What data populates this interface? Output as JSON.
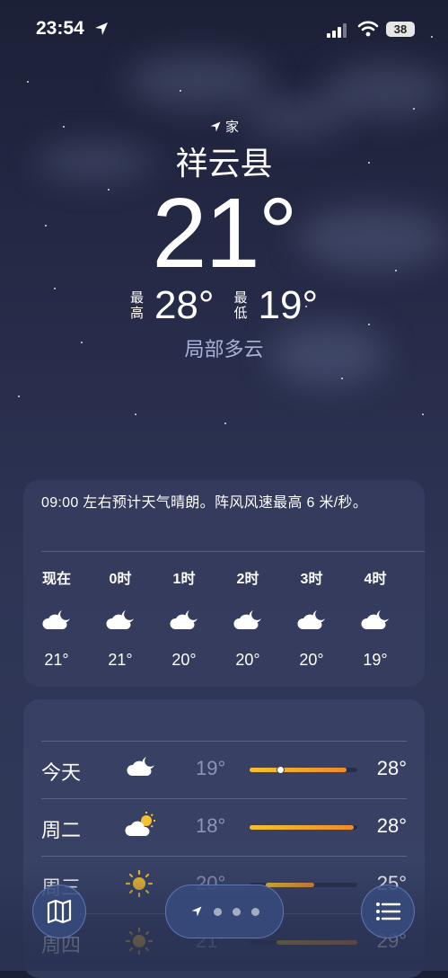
{
  "status_bar": {
    "time": "23:54",
    "battery": "38"
  },
  "location": {
    "label": "家",
    "city": "祥云县",
    "current_temp": "21°",
    "high_label": "最高",
    "high": "28°",
    "low_label": "最低",
    "low": "19°",
    "condition": "局部多云"
  },
  "hourly": {
    "summary": "09:00 左右预计天气晴朗。阵风风速最高 6 米/秒。",
    "hours": [
      {
        "label": "现在",
        "icon": "moon-cloud-icon",
        "temp": "21°"
      },
      {
        "label": "0时",
        "icon": "moon-cloud-icon",
        "temp": "21°"
      },
      {
        "label": "1时",
        "icon": "moon-cloud-icon",
        "temp": "20°"
      },
      {
        "label": "2时",
        "icon": "moon-cloud-icon",
        "temp": "20°"
      },
      {
        "label": "3时",
        "icon": "moon-cloud-icon",
        "temp": "20°"
      },
      {
        "label": "4时",
        "icon": "moon-cloud-icon",
        "temp": "19°"
      }
    ]
  },
  "daily": {
    "days": [
      {
        "name": "今天",
        "icon": "moon-cloud-icon",
        "low": "19°",
        "high": "28°",
        "bar_start": 0.0,
        "bar_end": 0.9,
        "current_dot": 0.28
      },
      {
        "name": "周二",
        "icon": "sun-cloud-icon",
        "low": "18°",
        "high": "28°",
        "bar_start": 0.0,
        "bar_end": 0.97
      },
      {
        "name": "周三",
        "icon": "sun-icon",
        "low": "20°",
        "high": "25°",
        "bar_start": 0.15,
        "bar_end": 0.6
      },
      {
        "name": "周四",
        "icon": "sun-icon",
        "low": "21°",
        "high": "29°",
        "bar_start": 0.25,
        "bar_end": 1.0
      }
    ]
  },
  "colors": {
    "bar_cool": "#f2c230",
    "bar_warm": "#f08a2a",
    "accent": "#3b7bf5"
  }
}
